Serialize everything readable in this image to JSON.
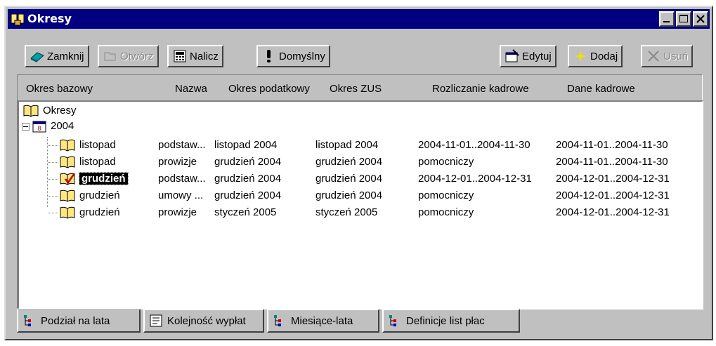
{
  "window": {
    "title": "Okresy"
  },
  "toolbar": {
    "close_label": "Zamknij",
    "open_label": "Otwórz",
    "calc_label": "Nalicz",
    "default_label": "Domyślny",
    "edit_label": "Edytuj",
    "add_label": "Dodaj",
    "delete_label": "Usuń"
  },
  "columns": [
    "Okres bazowy",
    "Nazwa",
    "Okres podatkowy",
    "Okres ZUS",
    "Rozliczanie kadrowe",
    "Dane kadrowe"
  ],
  "tree": {
    "root_label": "Okresy",
    "year_label": "2004",
    "rows": [
      {
        "base": "listopad",
        "name": "podstaw...",
        "tax": "listopad 2004",
        "zus": "listopad 2004",
        "hr_settlement": "2004-11-01..2004-11-30",
        "hr_data": "2004-11-01..2004-11-30"
      },
      {
        "base": "listopad",
        "name": "prowizje",
        "tax": "grudzień 2004",
        "zus": "grudzień 2004",
        "hr_settlement": "pomocniczy",
        "hr_data": "2004-11-01..2004-11-30"
      },
      {
        "base": "grudzień",
        "name": "podstaw...",
        "tax": "grudzień 2004",
        "zus": "grudzień 2004",
        "hr_settlement": "2004-12-01..2004-12-31",
        "hr_data": "2004-12-01..2004-12-31"
      },
      {
        "base": "grudzień",
        "name": "umowy ...",
        "tax": "grudzień 2004",
        "zus": "grudzień 2004",
        "hr_settlement": "pomocniczy",
        "hr_data": "2004-12-01..2004-12-31"
      },
      {
        "base": "grudzień",
        "name": "prowizje",
        "tax": "styczeń 2005",
        "zus": "styczeń 2005",
        "hr_settlement": "pomocniczy",
        "hr_data": "2004-12-01..2004-12-31"
      }
    ]
  },
  "tabs": [
    "Podział na lata",
    "Kolejność wypłat",
    "Miesiące-lata",
    "Definicje list płac"
  ],
  "colors": {
    "titlebar": "#000080",
    "face": "#c0c0c0",
    "selection": "#000000"
  }
}
